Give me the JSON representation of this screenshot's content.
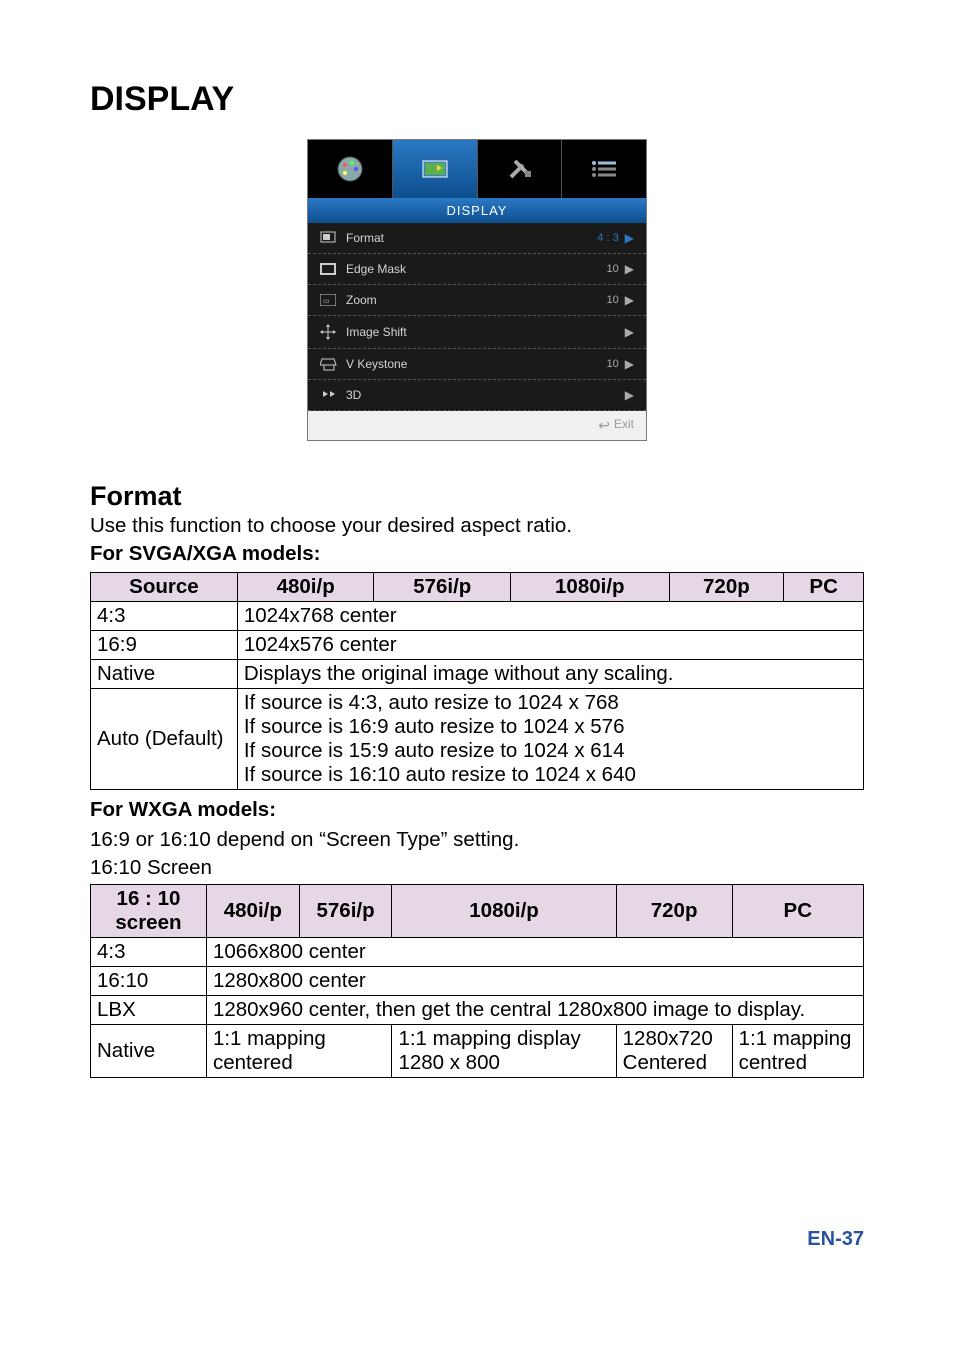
{
  "heading": "DISPLAY",
  "osd": {
    "title": "DISPLAY",
    "rows": {
      "format": {
        "label": "Format",
        "value": "4 : 3"
      },
      "edgeMask": {
        "label": "Edge Mask",
        "value": "10"
      },
      "zoom": {
        "label": "Zoom",
        "value": "10"
      },
      "imageShift": {
        "label": "Image Shift",
        "value": ""
      },
      "vKeystone": {
        "label": "V Keystone",
        "value": "10"
      },
      "threeD": {
        "label": "3D",
        "value": ""
      }
    },
    "exit": "Exit"
  },
  "format": {
    "heading": "Format",
    "desc": "Use this function to choose your desired aspect ratio."
  },
  "svga": {
    "label": "For SVGA/XGA models:",
    "headers": {
      "h1": "Source",
      "h2": "480i/p",
      "h3": "576i/p",
      "h4": "1080i/p",
      "h5": "720p",
      "h6": "PC"
    },
    "rows": {
      "r1c1": "4:3",
      "r1c2": "1024x768 center",
      "r2c1": "16:9",
      "r2c2": "1024x576 center",
      "r3c1": "Native",
      "r3c2": "Displays the original image without any scaling.",
      "r4c1": "Auto (Default)",
      "r4l1": "If source is 4:3, auto resize to 1024 x 768",
      "r4l2": "If source is 16:9 auto resize to 1024 x 576",
      "r4l3": "If source is 15:9 auto resize to 1024 x 614",
      "r4l4": "If source is 16:10 auto resize to 1024 x 640"
    }
  },
  "wxga": {
    "label": "For WXGA models:",
    "sub1": "16:9 or 16:10 depend on “Screen Type” setting.",
    "sub2": "16:10 Screen",
    "headers": {
      "h1": "16 : 10 screen",
      "h2": "480i/p",
      "h3": "576i/p",
      "h4": "1080i/p",
      "h5": "720p",
      "h6": "PC"
    },
    "rows": {
      "r1c1": "4:3",
      "r1c2": "1066x800 center",
      "r2c1": "16:10",
      "r2c2": "1280x800 center",
      "r3c1": "LBX",
      "r3c2": "1280x960 center, then get the central 1280x800 image to display.",
      "r4c1": "Native",
      "r4c2": "1:1 mapping centered",
      "r4c3": "1:1 mapping display 1280 x 800",
      "r4c4": "1280x720 Centered",
      "r4c5": "1:1 mapping centred"
    }
  },
  "pageNum": "EN-37"
}
